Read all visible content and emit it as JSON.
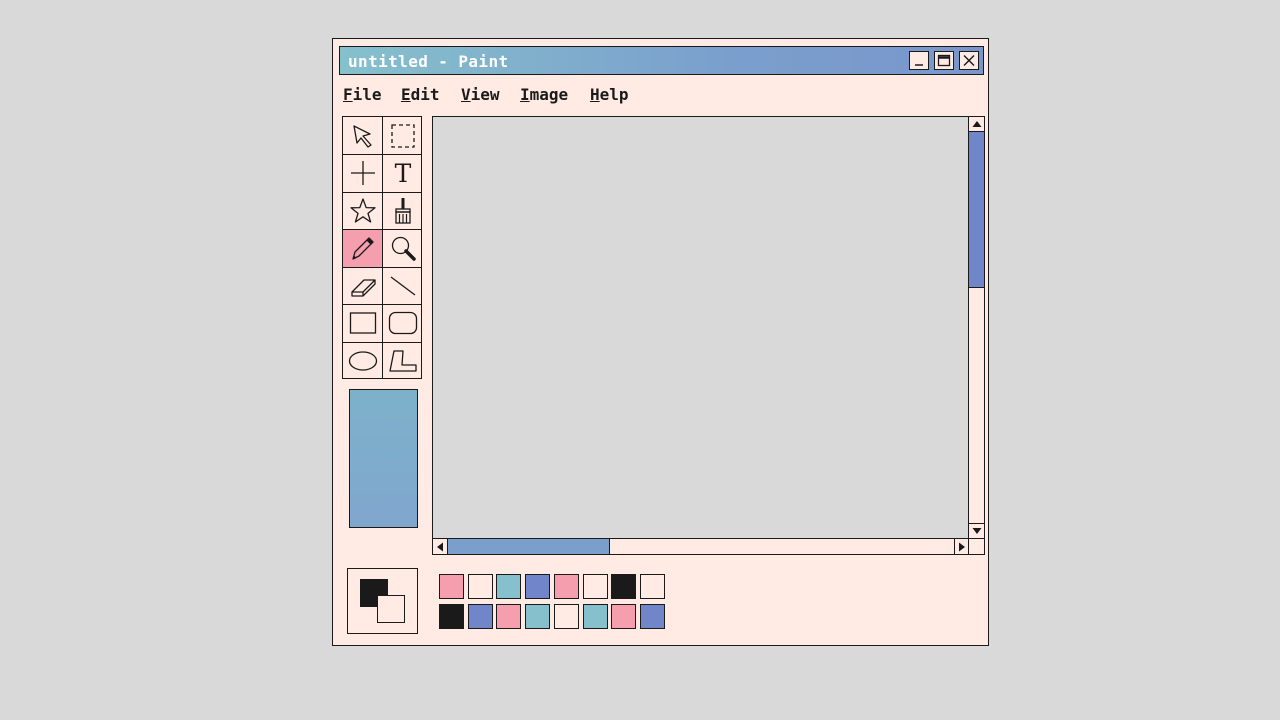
{
  "window": {
    "title": "untitled - Paint"
  },
  "title_buttons": [
    {
      "name": "minimize-button",
      "icon": "minimize-icon"
    },
    {
      "name": "maximize-button",
      "icon": "maximize-icon"
    },
    {
      "name": "close-button",
      "icon": "close-icon"
    }
  ],
  "menu": {
    "items": [
      {
        "first": "F",
        "rest": "ile"
      },
      {
        "first": "E",
        "rest": "dit"
      },
      {
        "first": "V",
        "rest": "iew"
      },
      {
        "first": "I",
        "rest": "mage"
      },
      {
        "first": "H",
        "rest": "elp"
      }
    ]
  },
  "tools": [
    {
      "icon": "pointer-arrow-icon",
      "selected": false
    },
    {
      "icon": "rectangle-select-icon",
      "selected": false
    },
    {
      "icon": "crosshair-icon",
      "selected": false
    },
    {
      "icon": "text-tool-icon",
      "label": "T",
      "selected": false
    },
    {
      "icon": "star-icon",
      "selected": false
    },
    {
      "icon": "brush-icon",
      "selected": false
    },
    {
      "icon": "pencil-icon",
      "selected": true
    },
    {
      "icon": "magnifier-icon",
      "selected": false
    },
    {
      "icon": "eraser-icon",
      "selected": false
    },
    {
      "icon": "line-icon",
      "selected": false
    },
    {
      "icon": "rectangle-icon",
      "selected": false
    },
    {
      "icon": "rounded-rectangle-icon",
      "selected": false
    },
    {
      "icon": "ellipse-icon",
      "selected": false
    },
    {
      "icon": "polygon-icon",
      "selected": false
    }
  ],
  "colors": {
    "accent_pink": "#f59eae",
    "teal": "#86c0cc",
    "blue": "#7086c8",
    "cream": "#ffebe3",
    "black": "#1a1a1a",
    "canvas": "#d9d9d9",
    "foreground": "#1a1a1a",
    "background": "#ffebe3"
  },
  "palette": {
    "row1": [
      "#f59eae",
      "#ffebe3",
      "#86c0cc",
      "#7086c8",
      "#f59eae",
      "#ffebe3",
      "#1a1a1a",
      "#ffebe3"
    ],
    "row2": [
      "#1a1a1a",
      "#7086c8",
      "#f59eae",
      "#86c0cc",
      "#ffebe3",
      "#86c0cc",
      "#f59eae",
      "#7086c8"
    ]
  },
  "scroll": {
    "vertical_thumb_fraction": 0.4,
    "vertical_position_fraction": 0.0,
    "horizontal_thumb_fraction": 0.32,
    "horizontal_position_fraction": 0.0
  }
}
